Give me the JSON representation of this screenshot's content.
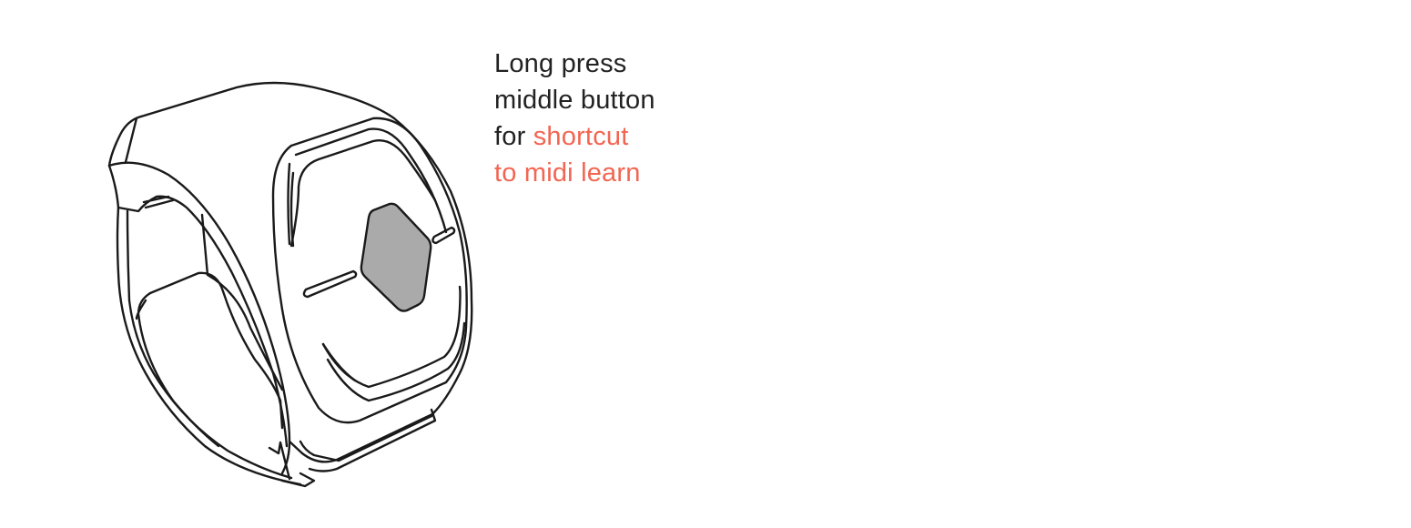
{
  "instruction": {
    "line1": "Long press",
    "line2": "middle button",
    "line3_prefix": "for",
    "line3_highlight": "shortcut",
    "line4_highlight": "to midi learn"
  },
  "colors": {
    "text": "#222222",
    "accent": "#f26552",
    "button_fill": "#aaaaaa",
    "outline": "#1a1a1a"
  },
  "illustration": {
    "icon": "ring-controller-icon",
    "highlighted_part": "middle-button"
  }
}
